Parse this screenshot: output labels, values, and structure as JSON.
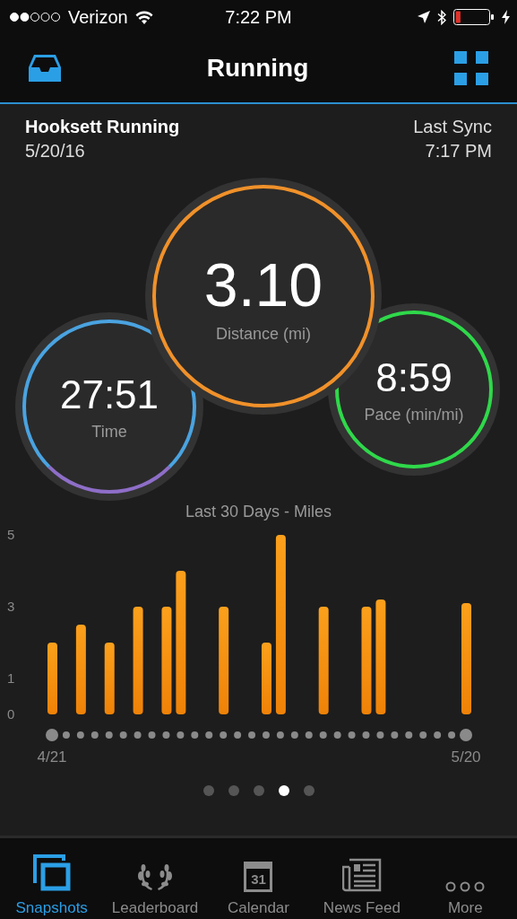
{
  "status_bar": {
    "signal_dots": [
      {
        "on": true
      },
      {
        "on": true
      },
      {
        "on": false
      },
      {
        "on": false
      },
      {
        "on": false
      }
    ],
    "carrier": "Verizon",
    "time": "7:22 PM",
    "battery": {
      "level": 0.15,
      "charging": true
    }
  },
  "header": {
    "title": "Running"
  },
  "activity": {
    "name": "Hooksett Running",
    "date": "5/20/16",
    "sync_label": "Last Sync",
    "sync_time": "7:17 PM"
  },
  "stats": [
    {
      "kind": "distance",
      "value": "3.10",
      "label": "Distance (mi)",
      "color": "#f0912a"
    },
    {
      "kind": "time",
      "value": "27:51",
      "label": "Time",
      "color": "#4aa3e0"
    },
    {
      "kind": "pace",
      "value": "8:59",
      "label": "Pace (min/mi)",
      "color": "#2fd84a"
    }
  ],
  "chart_data": {
    "type": "bar",
    "title": "Last 30 Days - Miles",
    "categories": [
      "4/21",
      null,
      null,
      null,
      null,
      null,
      null,
      null,
      null,
      null,
      null,
      null,
      null,
      null,
      null,
      null,
      null,
      null,
      null,
      null,
      null,
      null,
      null,
      null,
      null,
      null,
      null,
      null,
      null,
      "5/20"
    ],
    "values": [
      2.0,
      null,
      2.5,
      null,
      2.0,
      null,
      3.0,
      null,
      3.0,
      4.0,
      null,
      null,
      3.0,
      null,
      null,
      2.0,
      5.0,
      null,
      null,
      3.0,
      null,
      null,
      3.0,
      3.2,
      null,
      null,
      null,
      null,
      null,
      3.1
    ],
    "ylim": [
      0,
      5
    ],
    "yticks": [
      0,
      1,
      3,
      5
    ]
  },
  "pager": [
    {
      "selected": false
    },
    {
      "selected": false
    },
    {
      "selected": false
    },
    {
      "selected": true
    },
    {
      "selected": false
    }
  ],
  "tabs": [
    {
      "kind": "snapshots",
      "label": "Snapshots",
      "selected": true
    },
    {
      "kind": "leaderboard",
      "label": "Leaderboard",
      "selected": false
    },
    {
      "kind": "calendar",
      "label": "Calendar",
      "icon_text": "31",
      "selected": false
    },
    {
      "kind": "news",
      "label": "News Feed",
      "selected": false
    },
    {
      "kind": "more",
      "label": "More",
      "selected": false
    }
  ]
}
